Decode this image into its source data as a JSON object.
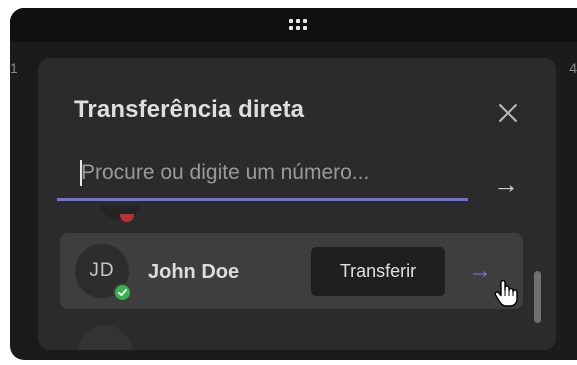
{
  "window": {
    "left_edge_label": "1",
    "right_edge_label": "4"
  },
  "dialog": {
    "title": "Transferência direta",
    "search": {
      "value": "",
      "placeholder": "Procure ou digite um número..."
    },
    "go_arrow": "→"
  },
  "contacts": [
    {
      "initials": "JD",
      "name": "John Doe",
      "presence": "available",
      "transfer_label": "Transferir",
      "arrow": "→"
    }
  ],
  "colors": {
    "accent": "#6f6fe0",
    "presence_available": "#36b24a",
    "presence_busy": "#b83232",
    "dialog_bg": "#2b2b2b",
    "row_bg": "#3e3e3e"
  },
  "icons": [
    "grip-icon",
    "close-icon",
    "arrow-right-icon",
    "check-icon",
    "hand-cursor-icon"
  ]
}
